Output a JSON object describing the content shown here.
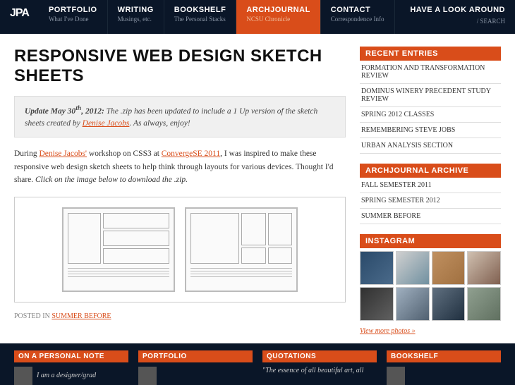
{
  "logo": "JPA",
  "nav": [
    {
      "title": "PORTFOLIO",
      "sub": "What I've Done"
    },
    {
      "title": "WRITING",
      "sub": "Musings, etc."
    },
    {
      "title": "BOOKSHELF",
      "sub": "The Personal Stacks"
    },
    {
      "title": "ARCHJOURNAL",
      "sub": "NCSU Chronicle"
    },
    {
      "title": "CONTACT",
      "sub": "Correspondence Info"
    }
  ],
  "search": {
    "title": "HAVE A LOOK AROUND",
    "label": "/ SEARCH"
  },
  "page": {
    "title": "RESPONSIVE WEB DESIGN SKETCH SHEETS",
    "update_prefix": "Update May 30",
    "update_sup": "th",
    "update_year": ", 2012:",
    "update_body1": " The .zip has been updated to include a 1 Up version of the sketch sheets created by ",
    "update_link": "Denise Jacobs",
    "update_body2": ". As always, enjoy!",
    "body_1": "During ",
    "body_link1": "Denise Jacobs'",
    "body_2": " workshop on CSS3 at ",
    "body_link2": "ConvergeSE 2011",
    "body_3": ", I was inspired to make these responsive web design sketch sheets to help think through layouts for various devices. Thought I'd share. ",
    "body_em": "Click on the image below to download the .zip.",
    "posted_label": "POSTED IN ",
    "posted_cat": "SUMMER BEFORE"
  },
  "sidebar": {
    "recent": {
      "title": "RECENT ENTRIES",
      "items": [
        "FORMATION AND TRANSFORMATION REVIEW",
        "DOMINUS WINERY PRECEDENT STUDY REVIEW",
        "SPRING 2012 CLASSES",
        "REMEMBERING STEVE JOBS",
        "URBAN ANALYSIS SECTION"
      ]
    },
    "archive": {
      "title": "ARCHJOURNAL ARCHIVE",
      "items": [
        "FALL SEMESTER 2011",
        "SPRING SEMESTER 2012",
        "SUMMER BEFORE"
      ]
    },
    "instagram": {
      "title": "INSTAGRAM",
      "more": "View more photos »"
    }
  },
  "footer": {
    "cols": [
      {
        "title": "ON A PERSONAL NOTE",
        "text": "I am a designer/grad"
      },
      {
        "title": "PORTFOLIO",
        "text": ""
      },
      {
        "title": "QUOTATIONS",
        "text": "\"The essence of all beautiful art, all"
      },
      {
        "title": "BOOKSHELF",
        "text": ""
      }
    ]
  }
}
